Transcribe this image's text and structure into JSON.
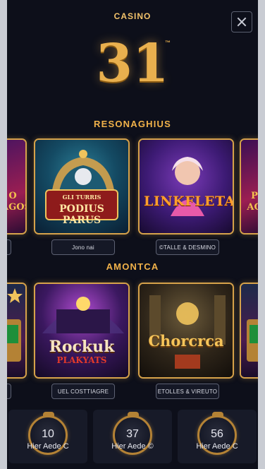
{
  "header": {
    "brand": "CASINO",
    "logo_number": "31",
    "logo_tm": "™"
  },
  "sections": [
    {
      "title": "RESONAGHIUS",
      "cards": [
        {
          "title": "",
          "caption": ""
        },
        {
          "title": "GLI TURRIS\nPODIUS PARUS",
          "caption": "Jono nai"
        },
        {
          "title": "LINKFLETA",
          "caption": "©TALLE & DESMINO"
        },
        {
          "title": "",
          "caption": ""
        }
      ],
      "partial_left_title": "O\nAGOS",
      "partial_right_title": "P\nAG"
    },
    {
      "title": "AMONTCA",
      "cards": [
        {
          "title": "",
          "caption": ""
        },
        {
          "title": "Rockuk\nPLAKYATS",
          "caption": "UEL COSTTIAGRE"
        },
        {
          "title": "Chorcrca",
          "caption": "ETOLLES & VIREUTO"
        },
        {
          "title": "",
          "caption": ""
        }
      ]
    }
  ],
  "stats": [
    {
      "number": "10",
      "label": "Hier Aede C"
    },
    {
      "number": "37",
      "label": "Hier Aede ©"
    },
    {
      "number": "56",
      "label": "Hier Aede C"
    }
  ],
  "colors": {
    "accent": "#f1b24a",
    "gold_border": "#d6a24a",
    "modal_bg": "#0d0f1a"
  },
  "icons": {
    "close": "close-icon"
  }
}
